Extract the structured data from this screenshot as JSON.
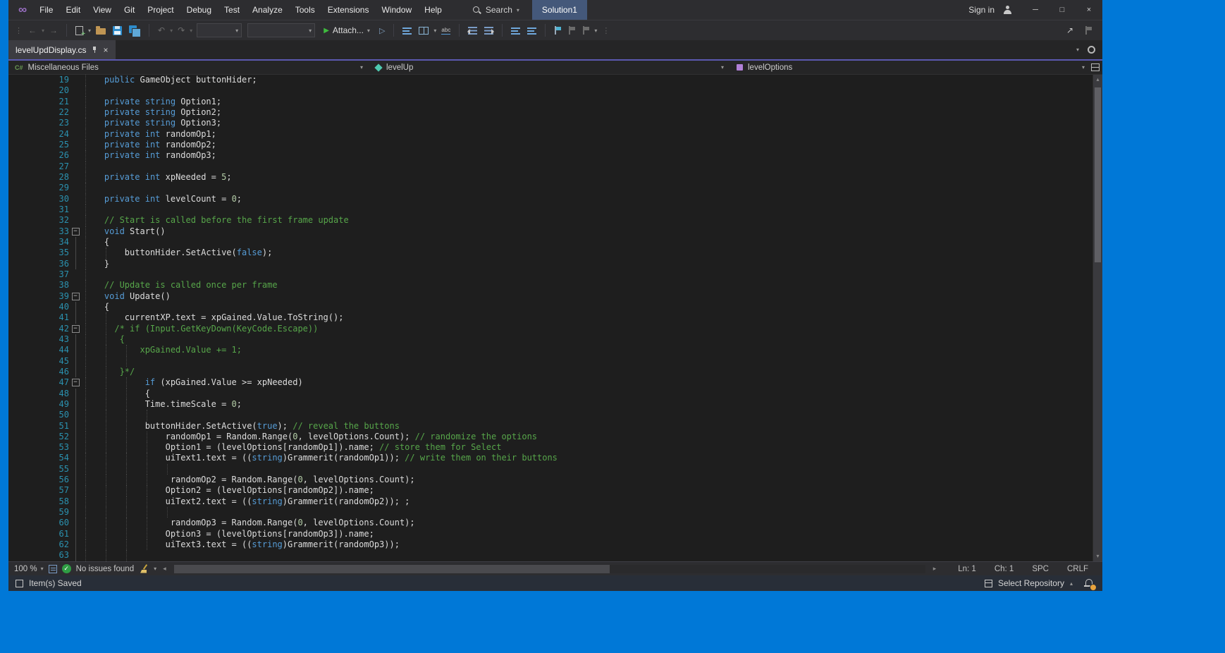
{
  "titlebar": {
    "menus": [
      "File",
      "Edit",
      "View",
      "Git",
      "Project",
      "Debug",
      "Test",
      "Analyze",
      "Tools",
      "Extensions",
      "Window",
      "Help"
    ],
    "search_label": "Search",
    "solution": "Solution1",
    "sign_in": "Sign in"
  },
  "toolbar": {
    "attach_label": "Attach..."
  },
  "tabs": {
    "active_tab": "levelUpdDisplay.cs"
  },
  "navbar": {
    "project": "Miscellaneous Files",
    "type": "levelUp",
    "member": "levelOptions"
  },
  "editor_status": {
    "zoom": "100 %",
    "issues": "No issues found",
    "line": "Ln: 1",
    "column": "Ch: 1",
    "encoding": "SPC",
    "line_ending": "CRLF"
  },
  "status_bar": {
    "left_label": "Item(s) Saved",
    "repo_label": "Select Repository"
  },
  "colors": {
    "desktop": "#0078D7",
    "accent_line": "#5B58B0",
    "keyword": "#569CD6",
    "comment": "#57A64A",
    "number": "#B5CEA8",
    "line_number": "#2B91AF",
    "status_ok": "#2F9E44",
    "notification_badge": "#E8A33D"
  },
  "icons": {
    "logo": "∞",
    "chevron-down": "▾",
    "chevron-up": "▴",
    "minimize": "─",
    "maximize": "□",
    "close": "×",
    "back": "←",
    "forward": "→",
    "undo": "↶",
    "redo": "↷",
    "run": "▶",
    "run-outline": "▷",
    "scroll-left": "◂",
    "scroll-right": "▸",
    "scroll-up": "▴",
    "scroll-down": "▾",
    "grip": "⋮",
    "overflow": "⋮",
    "close-tab": "×",
    "fold-collapse": "−",
    "share": "↗",
    "check": "✓"
  },
  "editor": {
    "lines": [
      {
        "n": 19,
        "g": [
          0
        ],
        "s": [
          [
            "    ",
            "d"
          ],
          [
            "public",
            "k"
          ],
          [
            " GameObject buttonHider;",
            "d"
          ]
        ]
      },
      {
        "n": 20,
        "g": [
          0
        ],
        "s": []
      },
      {
        "n": 21,
        "g": [
          0
        ],
        "s": [
          [
            "    ",
            "d"
          ],
          [
            "private",
            "k"
          ],
          [
            " ",
            "d"
          ],
          [
            "string",
            "k"
          ],
          [
            " Option1;",
            "d"
          ]
        ]
      },
      {
        "n": 22,
        "g": [
          0
        ],
        "s": [
          [
            "    ",
            "d"
          ],
          [
            "private",
            "k"
          ],
          [
            " ",
            "d"
          ],
          [
            "string",
            "k"
          ],
          [
            " Option2;",
            "d"
          ]
        ]
      },
      {
        "n": 23,
        "g": [
          0
        ],
        "s": [
          [
            "    ",
            "d"
          ],
          [
            "private",
            "k"
          ],
          [
            " ",
            "d"
          ],
          [
            "string",
            "k"
          ],
          [
            " Option3;",
            "d"
          ]
        ]
      },
      {
        "n": 24,
        "g": [
          0
        ],
        "s": [
          [
            "    ",
            "d"
          ],
          [
            "private",
            "k"
          ],
          [
            " ",
            "d"
          ],
          [
            "int",
            "k"
          ],
          [
            " randomOp1;",
            "d"
          ]
        ]
      },
      {
        "n": 25,
        "g": [
          0
        ],
        "s": [
          [
            "    ",
            "d"
          ],
          [
            "private",
            "k"
          ],
          [
            " ",
            "d"
          ],
          [
            "int",
            "k"
          ],
          [
            " randomOp2;",
            "d"
          ]
        ]
      },
      {
        "n": 26,
        "g": [
          0
        ],
        "s": [
          [
            "    ",
            "d"
          ],
          [
            "private",
            "k"
          ],
          [
            " ",
            "d"
          ],
          [
            "int",
            "k"
          ],
          [
            " randomOp3;",
            "d"
          ]
        ]
      },
      {
        "n": 27,
        "g": [
          0
        ],
        "s": []
      },
      {
        "n": 28,
        "g": [
          0
        ],
        "s": [
          [
            "    ",
            "d"
          ],
          [
            "private",
            "k"
          ],
          [
            " ",
            "d"
          ],
          [
            "int",
            "k"
          ],
          [
            " xpNeeded = ",
            "d"
          ],
          [
            "5",
            "n"
          ],
          [
            ";",
            "d"
          ]
        ]
      },
      {
        "n": 29,
        "g": [
          0
        ],
        "s": []
      },
      {
        "n": 30,
        "g": [
          0
        ],
        "s": [
          [
            "    ",
            "d"
          ],
          [
            "private",
            "k"
          ],
          [
            " ",
            "d"
          ],
          [
            "int",
            "k"
          ],
          [
            " levelCount = ",
            "d"
          ],
          [
            "0",
            "n"
          ],
          [
            ";",
            "d"
          ]
        ]
      },
      {
        "n": 31,
        "g": [
          0
        ],
        "s": []
      },
      {
        "n": 32,
        "g": [
          0
        ],
        "s": [
          [
            "    ",
            "d"
          ],
          [
            "// Start is called before the first frame update",
            "c"
          ]
        ]
      },
      {
        "n": 33,
        "g": [
          0
        ],
        "f": 1,
        "s": [
          [
            "    ",
            "d"
          ],
          [
            "void",
            "k"
          ],
          [
            " Start()",
            "d"
          ]
        ]
      },
      {
        "n": 34,
        "g": [
          0
        ],
        "i": 1,
        "s": [
          [
            "    {",
            "d"
          ]
        ]
      },
      {
        "n": 35,
        "g": [
          0,
          4
        ],
        "i": 1,
        "s": [
          [
            "        buttonHider.SetActive(",
            "d"
          ],
          [
            "false",
            "k"
          ],
          [
            ");",
            "d"
          ]
        ]
      },
      {
        "n": 36,
        "g": [
          0
        ],
        "i": 1,
        "s": [
          [
            "    }",
            "d"
          ]
        ]
      },
      {
        "n": 37,
        "g": [
          0
        ],
        "s": []
      },
      {
        "n": 38,
        "g": [
          0
        ],
        "s": [
          [
            "    ",
            "d"
          ],
          [
            "// Update is called once per frame",
            "c"
          ]
        ]
      },
      {
        "n": 39,
        "g": [
          0
        ],
        "f": 1,
        "s": [
          [
            "    ",
            "d"
          ],
          [
            "void",
            "k"
          ],
          [
            " Update()",
            "d"
          ]
        ]
      },
      {
        "n": 40,
        "g": [
          0
        ],
        "i": 1,
        "s": [
          [
            "    {",
            "d"
          ]
        ]
      },
      {
        "n": 41,
        "g": [
          0,
          4
        ],
        "i": 1,
        "s": [
          [
            "        currentXP.text = xpGained.Value.ToString();",
            "d"
          ]
        ]
      },
      {
        "n": 42,
        "g": [
          0,
          4
        ],
        "f": 1,
        "s": [
          [
            "      ",
            "d"
          ],
          [
            "/* if (Input.GetKeyDown(KeyCode.Escape))",
            "c"
          ]
        ]
      },
      {
        "n": 43,
        "g": [
          0,
          4
        ],
        "i": 1,
        "s": [
          [
            "       ",
            "d"
          ],
          [
            "{",
            "c"
          ]
        ]
      },
      {
        "n": 44,
        "g": [
          0,
          4,
          8
        ],
        "i": 1,
        "s": [
          [
            "           ",
            "d"
          ],
          [
            "xpGained.Value += 1;",
            "c"
          ]
        ]
      },
      {
        "n": 45,
        "g": [
          0,
          4,
          8
        ],
        "i": 1,
        "s": []
      },
      {
        "n": 46,
        "g": [
          0,
          4
        ],
        "i": 1,
        "s": [
          [
            "       ",
            "d"
          ],
          [
            "}*/",
            "c"
          ]
        ]
      },
      {
        "n": 47,
        "g": [
          0,
          4,
          8
        ],
        "f": 1,
        "s": [
          [
            "            ",
            "d"
          ],
          [
            "if",
            "k"
          ],
          [
            " (xpGained.Value >= xpNeeded)",
            "d"
          ]
        ]
      },
      {
        "n": 48,
        "g": [
          0,
          4,
          8
        ],
        "i": 1,
        "s": [
          [
            "            {",
            "d"
          ]
        ]
      },
      {
        "n": 49,
        "g": [
          0,
          4,
          8
        ],
        "i": 1,
        "s": [
          [
            "            Time.timeScale = ",
            "d"
          ],
          [
            "0",
            "n"
          ],
          [
            ";",
            "d"
          ]
        ]
      },
      {
        "n": 50,
        "g": [
          0,
          4,
          8,
          12
        ],
        "i": 1,
        "s": []
      },
      {
        "n": 51,
        "g": [
          0,
          4,
          8
        ],
        "i": 1,
        "s": [
          [
            "            buttonHider.SetActive(",
            "d"
          ],
          [
            "true",
            "k"
          ],
          [
            "); ",
            "d"
          ],
          [
            "// reveal the buttons",
            "c"
          ]
        ]
      },
      {
        "n": 52,
        "g": [
          0,
          4,
          8,
          12
        ],
        "i": 1,
        "s": [
          [
            "                randomOp1 = Random.Range(",
            "d"
          ],
          [
            "0",
            "n"
          ],
          [
            ", levelOptions.Count); ",
            "d"
          ],
          [
            "// randomize the options",
            "c"
          ]
        ]
      },
      {
        "n": 53,
        "g": [
          0,
          4,
          8,
          12
        ],
        "i": 1,
        "s": [
          [
            "                Option1 = (levelOptions[randomOp1]).name; ",
            "d"
          ],
          [
            "// store them for Select",
            "c"
          ]
        ]
      },
      {
        "n": 54,
        "g": [
          0,
          4,
          8,
          12
        ],
        "i": 1,
        "s": [
          [
            "                uiText1.text = ((",
            "d"
          ],
          [
            "string",
            "k"
          ],
          [
            ")Grammerit(randomOp1)); ",
            "d"
          ],
          [
            "// write them on their buttons",
            "c"
          ]
        ]
      },
      {
        "n": 55,
        "g": [
          0,
          4,
          8,
          12,
          16
        ],
        "i": 1,
        "s": []
      },
      {
        "n": 56,
        "g": [
          0,
          4,
          8,
          12
        ],
        "i": 1,
        "s": [
          [
            "                 randomOp2 = Random.Range(",
            "d"
          ],
          [
            "0",
            "n"
          ],
          [
            ", levelOptions.Count);",
            "d"
          ]
        ]
      },
      {
        "n": 57,
        "g": [
          0,
          4,
          8,
          12
        ],
        "i": 1,
        "s": [
          [
            "                Option2 = (levelOptions[randomOp2]).name;",
            "d"
          ]
        ]
      },
      {
        "n": 58,
        "g": [
          0,
          4,
          8,
          12
        ],
        "i": 1,
        "s": [
          [
            "                uiText2.text = ((",
            "d"
          ],
          [
            "string",
            "k"
          ],
          [
            ")Grammerit(randomOp2)); ;",
            "d"
          ]
        ]
      },
      {
        "n": 59,
        "g": [
          0,
          4,
          8,
          12,
          16
        ],
        "i": 1,
        "s": []
      },
      {
        "n": 60,
        "g": [
          0,
          4,
          8,
          12
        ],
        "i": 1,
        "s": [
          [
            "                 randomOp3 = Random.Range(",
            "d"
          ],
          [
            "0",
            "n"
          ],
          [
            ", levelOptions.Count);",
            "d"
          ]
        ]
      },
      {
        "n": 61,
        "g": [
          0,
          4,
          8,
          12
        ],
        "i": 1,
        "s": [
          [
            "                Option3 = (levelOptions[randomOp3]).name;",
            "d"
          ]
        ]
      },
      {
        "n": 62,
        "g": [
          0,
          4,
          8,
          12
        ],
        "i": 1,
        "s": [
          [
            "                uiText3.text = ((",
            "d"
          ],
          [
            "string",
            "k"
          ],
          [
            ")Grammerit(randomOp3));",
            "d"
          ]
        ]
      },
      {
        "n": 63,
        "g": [
          0,
          4,
          8
        ],
        "i": 1,
        "s": []
      }
    ]
  }
}
